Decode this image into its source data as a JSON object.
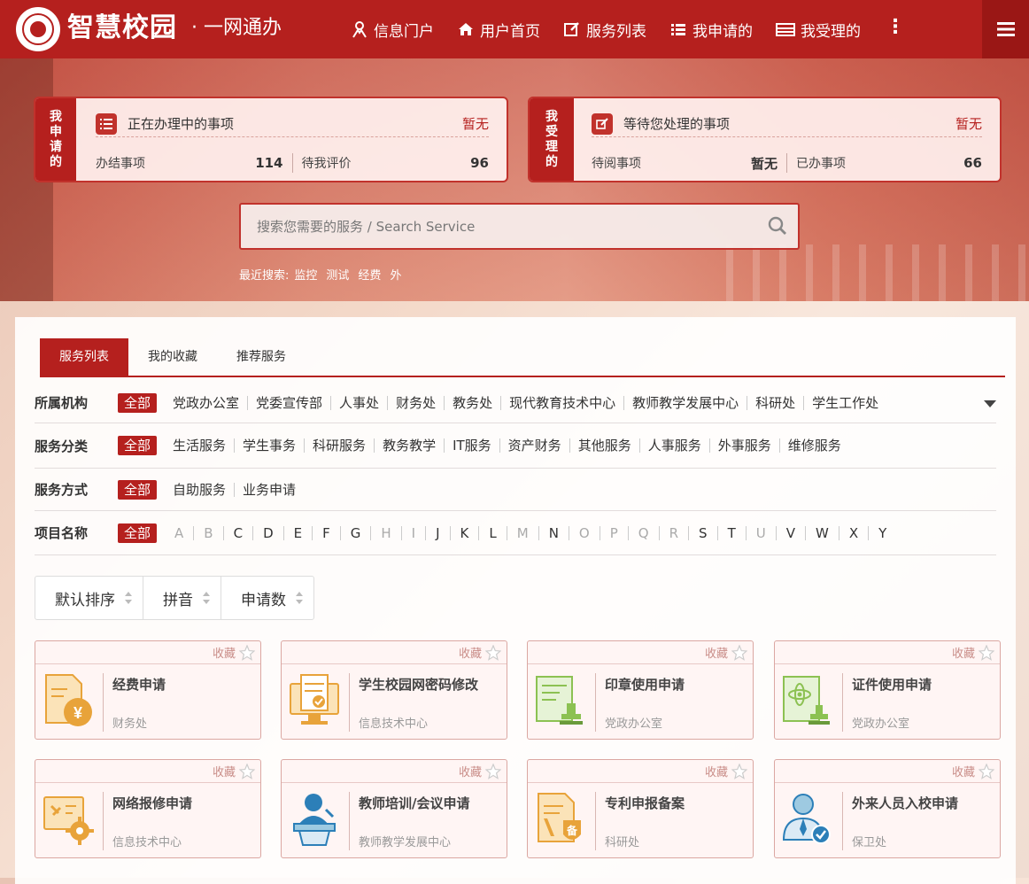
{
  "header": {
    "brand": "智慧校园",
    "brand_sub": "· 一网通办",
    "nav": [
      "信息门户",
      "用户首页",
      "服务列表",
      "我申请的",
      "我受理的"
    ],
    "more": "⋮"
  },
  "applied_card": {
    "side": "我申请的",
    "title": "正在办理中的事项",
    "status": "暂无",
    "stats": [
      {
        "label": "办结事项",
        "value": "114"
      },
      {
        "label": "待我评价",
        "value": "96"
      }
    ]
  },
  "handled_card": {
    "side": "我受理的",
    "title": "等待您处理的事项",
    "status": "暂无",
    "stats": [
      {
        "label": "待阅事项",
        "value": "暂无"
      },
      {
        "label": "已办事项",
        "value": "66"
      }
    ]
  },
  "search": {
    "placeholder": "搜索您需要的服务 / Search Service",
    "recent_label": "最近搜索:",
    "recent": [
      "监控",
      "测试",
      "经费",
      "外"
    ]
  },
  "tabs": [
    "服务列表",
    "我的收藏",
    "推荐服务"
  ],
  "filters": {
    "org": {
      "label": "所属机构",
      "all": "全部",
      "options": [
        "党政办公室",
        "党委宣传部",
        "人事处",
        "财务处",
        "教务处",
        "现代教育技术中心",
        "教师教学发展中心",
        "科研处",
        "学生工作处"
      ]
    },
    "category": {
      "label": "服务分类",
      "all": "全部",
      "options": [
        "生活服务",
        "学生事务",
        "科研服务",
        "教务教学",
        "IT服务",
        "资产财务",
        "其他服务",
        "人事服务",
        "外事服务",
        "维修服务"
      ]
    },
    "mode": {
      "label": "服务方式",
      "all": "全部",
      "options": [
        "自助服务",
        "业务申请"
      ]
    },
    "letters": {
      "label": "项目名称",
      "all": "全部",
      "options": [
        "A",
        "B",
        "C",
        "D",
        "E",
        "F",
        "G",
        "H",
        "I",
        "J",
        "K",
        "L",
        "M",
        "N",
        "O",
        "P",
        "Q",
        "R",
        "S",
        "T",
        "U",
        "V",
        "W",
        "X",
        "Y"
      ],
      "dimmed": [
        "A",
        "B",
        "H",
        "I",
        "M",
        "O",
        "P",
        "Q",
        "R",
        "U"
      ]
    }
  },
  "sort": [
    "默认排序",
    "拼音",
    "申请数"
  ],
  "fav_label": "收藏",
  "cards": [
    {
      "title": "经费申请",
      "dept": "财务处",
      "icon": "finance-doc-icon"
    },
    {
      "title": "学生校园网密码修改",
      "dept": "信息技术中心",
      "icon": "computer-check-icon"
    },
    {
      "title": "印章使用申请",
      "dept": "党政办公室",
      "icon": "seal-doc-icon"
    },
    {
      "title": "证件使用申请",
      "dept": "党政办公室",
      "icon": "certificate-doc-icon"
    },
    {
      "title": "网络报修申请",
      "dept": "信息技术中心",
      "icon": "repair-gear-icon"
    },
    {
      "title": "教师培训/会议申请",
      "dept": "教师教学发展中心",
      "icon": "lecturer-podium-icon"
    },
    {
      "title": "专利申报备案",
      "dept": "科研处",
      "icon": "patent-doc-icon"
    },
    {
      "title": "外来人员入校申请",
      "dept": "保卫处",
      "icon": "visitor-check-icon"
    }
  ],
  "colors": {
    "primary": "#b5201e",
    "primary_dark": "#9a1715",
    "icon_orange": "#e8a33a",
    "icon_green": "#8cc152",
    "icon_blue": "#2c7fb8"
  }
}
